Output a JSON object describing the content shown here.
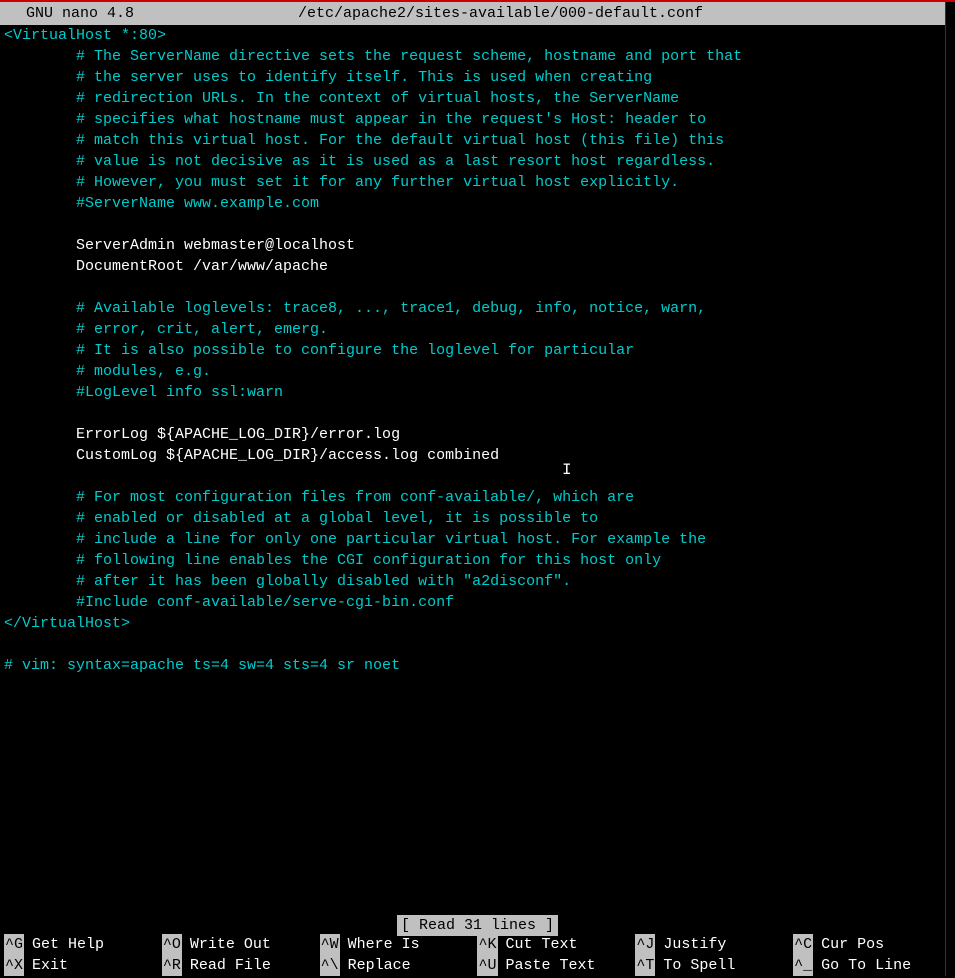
{
  "titlebar": {
    "app": "  GNU nano 4.8",
    "filename": "/etc/apache2/sites-available/000-default.conf"
  },
  "lines": [
    {
      "indent": 0,
      "cls": "directive",
      "text": "<VirtualHost *:80>"
    },
    {
      "indent": 8,
      "cls": "comment",
      "text": "# The ServerName directive sets the request scheme, hostname and port that"
    },
    {
      "indent": 8,
      "cls": "comment",
      "text": "# the server uses to identify itself. This is used when creating"
    },
    {
      "indent": 8,
      "cls": "comment",
      "text": "# redirection URLs. In the context of virtual hosts, the ServerName"
    },
    {
      "indent": 8,
      "cls": "comment",
      "text": "# specifies what hostname must appear in the request's Host: header to"
    },
    {
      "indent": 8,
      "cls": "comment",
      "text": "# match this virtual host. For the default virtual host (this file) this"
    },
    {
      "indent": 8,
      "cls": "comment",
      "text": "# value is not decisive as it is used as a last resort host regardless."
    },
    {
      "indent": 8,
      "cls": "comment",
      "text": "# However, you must set it for any further virtual host explicitly."
    },
    {
      "indent": 8,
      "cls": "comment",
      "text": "#ServerName www.example.com"
    },
    {
      "indent": 0,
      "cls": "plain",
      "text": ""
    },
    {
      "indent": 8,
      "cls": "plain",
      "text": "ServerAdmin webmaster@localhost"
    },
    {
      "indent": 8,
      "cls": "plain",
      "text": "DocumentRoot /var/www/apache"
    },
    {
      "indent": 0,
      "cls": "plain",
      "text": ""
    },
    {
      "indent": 8,
      "cls": "comment",
      "text": "# Available loglevels: trace8, ..., trace1, debug, info, notice, warn,"
    },
    {
      "indent": 8,
      "cls": "comment",
      "text": "# error, crit, alert, emerg."
    },
    {
      "indent": 8,
      "cls": "comment",
      "text": "# It is also possible to configure the loglevel for particular"
    },
    {
      "indent": 8,
      "cls": "comment",
      "text": "# modules, e.g."
    },
    {
      "indent": 8,
      "cls": "comment",
      "text": "#LogLevel info ssl:warn"
    },
    {
      "indent": 0,
      "cls": "plain",
      "text": ""
    },
    {
      "indent": 8,
      "cls": "plain",
      "text": "ErrorLog ${APACHE_LOG_DIR}/error.log"
    },
    {
      "indent": 8,
      "cls": "plain",
      "text": "CustomLog ${APACHE_LOG_DIR}/access.log combined"
    },
    {
      "indent": 0,
      "cls": "plain",
      "text": ""
    },
    {
      "indent": 8,
      "cls": "comment",
      "text": "# For most configuration files from conf-available/, which are"
    },
    {
      "indent": 8,
      "cls": "comment",
      "text": "# enabled or disabled at a global level, it is possible to"
    },
    {
      "indent": 8,
      "cls": "comment",
      "text": "# include a line for only one particular virtual host. For example the"
    },
    {
      "indent": 8,
      "cls": "comment",
      "text": "# following line enables the CGI configuration for this host only"
    },
    {
      "indent": 8,
      "cls": "comment",
      "text": "# after it has been globally disabled with \"a2disconf\"."
    },
    {
      "indent": 8,
      "cls": "comment",
      "text": "#Include conf-available/serve-cgi-bin.conf"
    },
    {
      "indent": 0,
      "cls": "directive",
      "text": "</VirtualHost>"
    },
    {
      "indent": 0,
      "cls": "plain",
      "text": ""
    },
    {
      "indent": 0,
      "cls": "comment",
      "text": "# vim: syntax=apache ts=4 sw=4 sts=4 sr noet"
    }
  ],
  "status": "[ Read 31 lines ]",
  "shortcuts_row1": [
    {
      "key": "^G",
      "label": "Get Help"
    },
    {
      "key": "^O",
      "label": "Write Out"
    },
    {
      "key": "^W",
      "label": "Where Is"
    },
    {
      "key": "^K",
      "label": "Cut Text"
    },
    {
      "key": "^J",
      "label": "Justify"
    },
    {
      "key": "^C",
      "label": "Cur Pos"
    }
  ],
  "shortcuts_row2": [
    {
      "key": "^X",
      "label": "Exit"
    },
    {
      "key": "^R",
      "label": "Read File"
    },
    {
      "key": "^\\",
      "label": "Replace"
    },
    {
      "key": "^U",
      "label": "Paste Text"
    },
    {
      "key": "^T",
      "label": "To Spell"
    },
    {
      "key": "^_",
      "label": "Go To Line"
    }
  ]
}
